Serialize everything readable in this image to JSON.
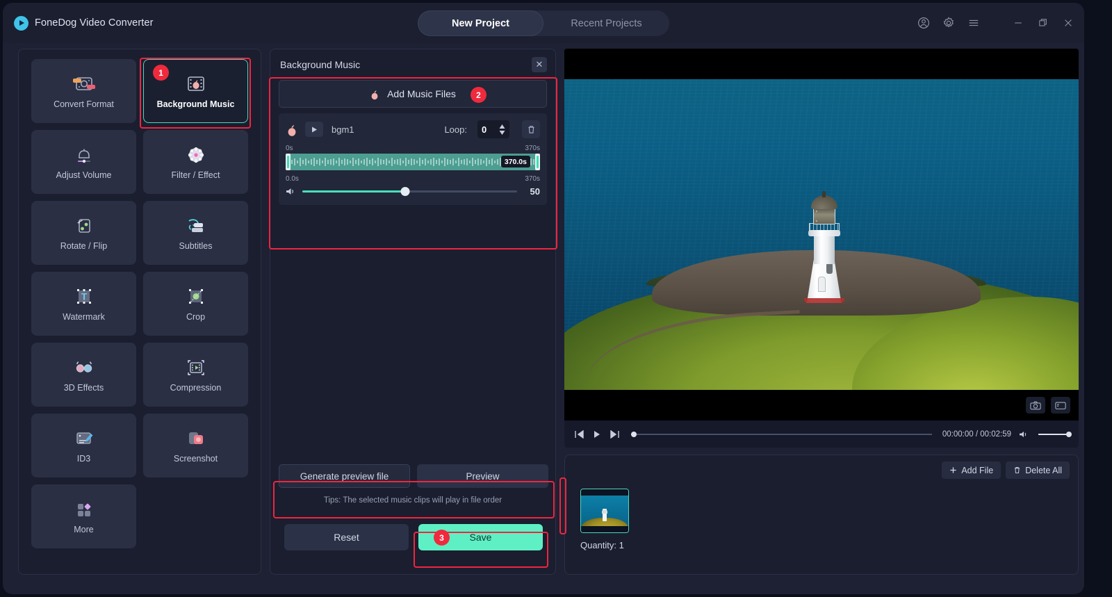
{
  "app": {
    "name": "FoneDog Video Converter",
    "logo_icon": "play-circle-logo"
  },
  "tabs": [
    {
      "label": "New Project",
      "active": true
    },
    {
      "label": "Recent Projects",
      "active": false
    }
  ],
  "window_controls": [
    {
      "name": "account-icon",
      "label": "Account"
    },
    {
      "name": "settings-gear-icon",
      "label": "Settings"
    },
    {
      "name": "hamburger-menu-icon",
      "label": "Menu"
    },
    {
      "name": "minimize-icon",
      "label": "Minimize"
    },
    {
      "name": "maximize-icon",
      "label": "Maximize"
    },
    {
      "name": "close-icon",
      "label": "Close"
    }
  ],
  "sidebar": {
    "tiles": [
      {
        "label": "Convert Format",
        "icon": "convert-format-icon",
        "selected": false
      },
      {
        "label": "Background Music",
        "icon": "background-music-icon",
        "selected": true,
        "badge": "1"
      },
      {
        "label": "Adjust Volume",
        "icon": "adjust-volume-icon",
        "selected": false
      },
      {
        "label": "Filter / Effect",
        "icon": "filter-effect-icon",
        "selected": false
      },
      {
        "label": "Rotate / Flip",
        "icon": "rotate-flip-icon",
        "selected": false
      },
      {
        "label": "Subtitles",
        "icon": "subtitles-icon",
        "selected": false
      },
      {
        "label": "Watermark",
        "icon": "watermark-icon",
        "selected": false
      },
      {
        "label": "Crop",
        "icon": "crop-icon",
        "selected": false
      },
      {
        "label": "3D Effects",
        "icon": "3d-effects-icon",
        "selected": false
      },
      {
        "label": "Compression",
        "icon": "compression-icon",
        "selected": false
      },
      {
        "label": "ID3",
        "icon": "id3-icon",
        "selected": false
      },
      {
        "label": "Screenshot",
        "icon": "screenshot-icon",
        "selected": false
      },
      {
        "label": "More",
        "icon": "more-icon",
        "selected": false
      }
    ]
  },
  "middle_panel": {
    "title": "Background Music",
    "close_label": "✕",
    "add_music": {
      "label": "Add Music Files",
      "icon": "music-note-icon",
      "badge": "2"
    },
    "track": {
      "name": "bgm1",
      "music_icon": "music-note-icon",
      "play_icon": "play-icon",
      "loop_label": "Loop:",
      "loop_value": "0",
      "delete_icon": "trash-icon",
      "range_start_label": "0s",
      "range_end_label": "370s",
      "trim_start_label": "0.0s",
      "trim_end_label": "370s",
      "selection_badge": "370.0s",
      "volume_icon": "speaker-icon",
      "volume_value": "50"
    },
    "generate_preview_label": "Generate preview file",
    "preview_label": "Preview",
    "tips": "Tips: The selected music clips will play in file order",
    "reset_label": "Reset",
    "save_label": "Save",
    "save_badge": "3"
  },
  "player": {
    "prev_icon": "skip-previous-icon",
    "play_icon": "play-icon",
    "next_icon": "skip-next-icon",
    "time": "00:00:00 / 00:02:59",
    "volume_icon": "speaker-icon",
    "snapshot_icon": "camera-icon",
    "gif_icon": "gif-capture-icon"
  },
  "file_list": {
    "add_file_label": "Add File",
    "add_file_icon": "plus-icon",
    "delete_all_label": "Delete All",
    "delete_all_icon": "trash-icon",
    "quantity_label": "Quantity: 1",
    "thumbnail_name": "lighthouse-thumbnail"
  },
  "colors": {
    "accent_green": "#5ef0c4",
    "highlight_red": "#f0253f",
    "badge_red": "#ef2a3d",
    "panel_bg": "#1a1e2f",
    "tile_bg": "#2a2f44",
    "waveform": "#4c9e92"
  }
}
